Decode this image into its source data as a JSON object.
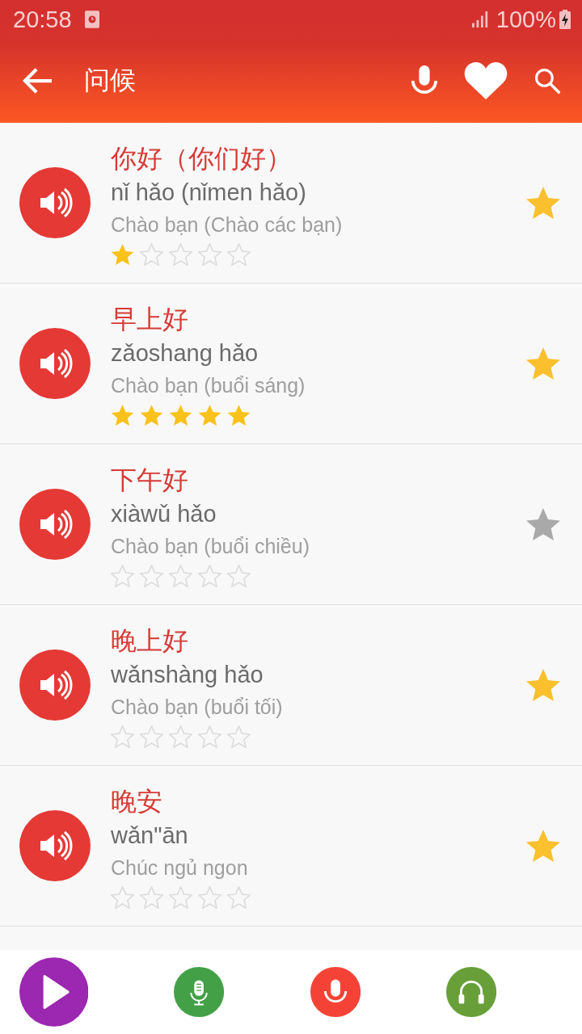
{
  "status_bar": {
    "time": "20:58",
    "battery": "100%"
  },
  "app_bar": {
    "title": "问候"
  },
  "phrases": [
    {
      "chinese": "你好（你们好）",
      "pinyin": "nǐ hǎo (nǐmen hǎo)",
      "translation": "Chào bạn (Chào các bạn)",
      "stars": 1,
      "favorite": true
    },
    {
      "chinese": "早上好",
      "pinyin": "zǎoshang hǎo",
      "translation": "Chào bạn (buổi sáng)",
      "stars": 5,
      "favorite": true
    },
    {
      "chinese": "下午好",
      "pinyin": "xiàwǔ hǎo",
      "translation": "Chào bạn (buổi chiều)",
      "stars": 0,
      "favorite": false
    },
    {
      "chinese": "晚上好",
      "pinyin": "wǎnshàng hǎo",
      "translation": "Chào bạn (buổi tối)",
      "stars": 0,
      "favorite": true
    },
    {
      "chinese": "晚安",
      "pinyin": "wǎn\"ān",
      "translation": "Chúc ngủ ngon",
      "stars": 0,
      "favorite": true
    }
  ]
}
